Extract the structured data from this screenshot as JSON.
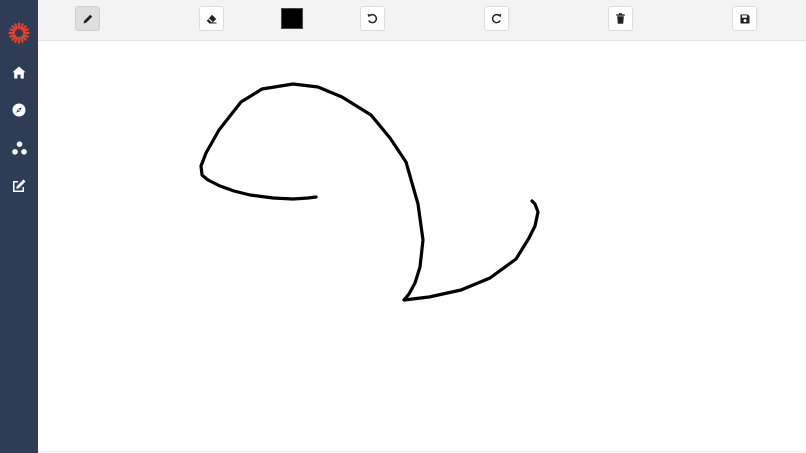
{
  "sidebar": {
    "logo_icon": "sunburst-logo-icon",
    "logo_color": "#e8412c",
    "items": [
      {
        "icon": "home-icon"
      },
      {
        "icon": "compass-icon"
      },
      {
        "icon": "network-icon"
      },
      {
        "icon": "pen-tool-icon"
      }
    ]
  },
  "toolbar": {
    "tools": [
      {
        "name": "pencil",
        "icon": "pencil-icon",
        "active": true
      },
      {
        "name": "eraser",
        "icon": "eraser-icon",
        "active": false
      },
      {
        "name": "color",
        "value": "#000000"
      },
      {
        "name": "undo",
        "icon": "undo-icon"
      },
      {
        "name": "redo",
        "icon": "redo-icon"
      },
      {
        "name": "clear",
        "icon": "trash-icon"
      },
      {
        "name": "save",
        "icon": "save-icon"
      }
    ]
  },
  "canvas": {
    "background": "#ffffff",
    "stroke_color": "#000000"
  }
}
